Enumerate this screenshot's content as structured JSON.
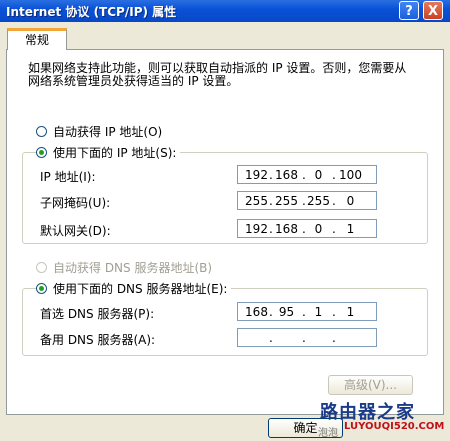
{
  "window": {
    "title": "Internet 协议 (TCP/IP) 属性",
    "help_label": "?",
    "close_label": "X"
  },
  "tabs": [
    {
      "label": "常规"
    }
  ],
  "description": "如果网络支持此功能，则可以获取自动指派的 IP 设置。否则，您需要从网络系统管理员处获得适当的 IP 设置。",
  "ip_section": {
    "auto_label": "自动获得 IP 地址(O)",
    "manual_label": "使用下面的 IP 地址(S):",
    "selected": "manual",
    "fields": [
      {
        "label": "IP 地址(I):",
        "octets": [
          "192",
          "168",
          "0",
          "100"
        ]
      },
      {
        "label": "子网掩码(U):",
        "octets": [
          "255",
          "255",
          "255",
          "0"
        ]
      },
      {
        "label": "默认网关(D):",
        "octets": [
          "192",
          "168",
          "0",
          "1"
        ]
      }
    ]
  },
  "dns_section": {
    "auto_label": "自动获得 DNS 服务器地址(B)",
    "manual_label": "使用下面的 DNS 服务器地址(E):",
    "selected": "manual",
    "fields": [
      {
        "label": "首选 DNS 服务器(P):",
        "octets": [
          "168",
          "95",
          "1",
          "1"
        ]
      },
      {
        "label": "备用 DNS 服务器(A):",
        "octets": [
          "",
          "",
          "",
          ""
        ]
      }
    ]
  },
  "buttons": {
    "advanced": "高级(V)...",
    "ok": "确定"
  },
  "watermark": {
    "text": "路由器之家",
    "url": "LUYOUQI520.COM",
    "small": "泡泡"
  }
}
